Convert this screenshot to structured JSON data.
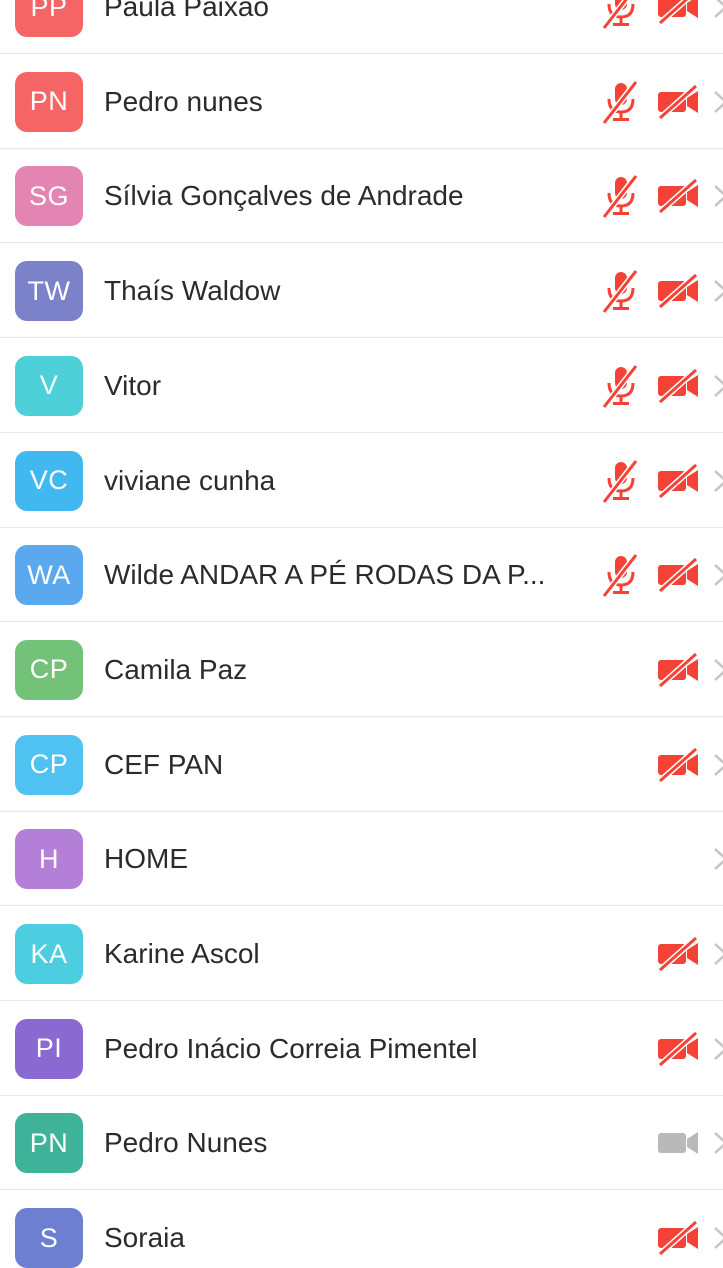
{
  "participants": [
    {
      "initials": "PP",
      "name": "Paula Paixão",
      "color": "#f56565",
      "mic_muted": true,
      "video": "off"
    },
    {
      "initials": "PN",
      "name": "Pedro nunes",
      "color": "#f56565",
      "mic_muted": true,
      "video": "off"
    },
    {
      "initials": "SG",
      "name": "Sílvia Gonçalves de Andrade",
      "color": "#e384b3",
      "mic_muted": true,
      "video": "off"
    },
    {
      "initials": "TW",
      "name": "Thaís Waldow",
      "color": "#7b82c9",
      "mic_muted": true,
      "video": "off"
    },
    {
      "initials": "V",
      "name": "Vitor",
      "color": "#4dd0d8",
      "mic_muted": true,
      "video": "off"
    },
    {
      "initials": "VC",
      "name": "viviane cunha",
      "color": "#41b9f0",
      "mic_muted": true,
      "video": "off"
    },
    {
      "initials": "WA",
      "name": "Wilde ANDAR A PÉ RODAS DA P...",
      "color": "#5aa9ef",
      "mic_muted": true,
      "video": "off"
    },
    {
      "initials": "CP",
      "name": "Camila Paz",
      "color": "#74c27a",
      "mic_muted": false,
      "video": "off"
    },
    {
      "initials": "CP",
      "name": "CEF PAN",
      "color": "#4fc2f2",
      "mic_muted": false,
      "video": "off"
    },
    {
      "initials": "H",
      "name": "HOME",
      "color": "#b47fd6",
      "mic_muted": false,
      "video": "none"
    },
    {
      "initials": "KA",
      "name": "Karine Ascol",
      "color": "#4ccde0",
      "mic_muted": false,
      "video": "off"
    },
    {
      "initials": "PI",
      "name": "Pedro Inácio Correia Pimentel",
      "color": "#8a6ad0",
      "mic_muted": false,
      "video": "off"
    },
    {
      "initials": "PN",
      "name": "Pedro Nunes",
      "color": "#3fb39a",
      "mic_muted": false,
      "video": "on"
    },
    {
      "initials": "S",
      "name": "Soraia",
      "color": "#6c7fd0",
      "mic_muted": false,
      "video": "off"
    }
  ],
  "colors": {
    "muted_red": "#f44336",
    "camera_on_grey": "#b9b9b9",
    "chevron_grey": "#c4c4c4"
  },
  "icons": {
    "mic": "mic-muted-icon",
    "camera_off": "video-off-icon",
    "camera_on": "video-on-icon",
    "chevron": "chevron-right-icon"
  }
}
